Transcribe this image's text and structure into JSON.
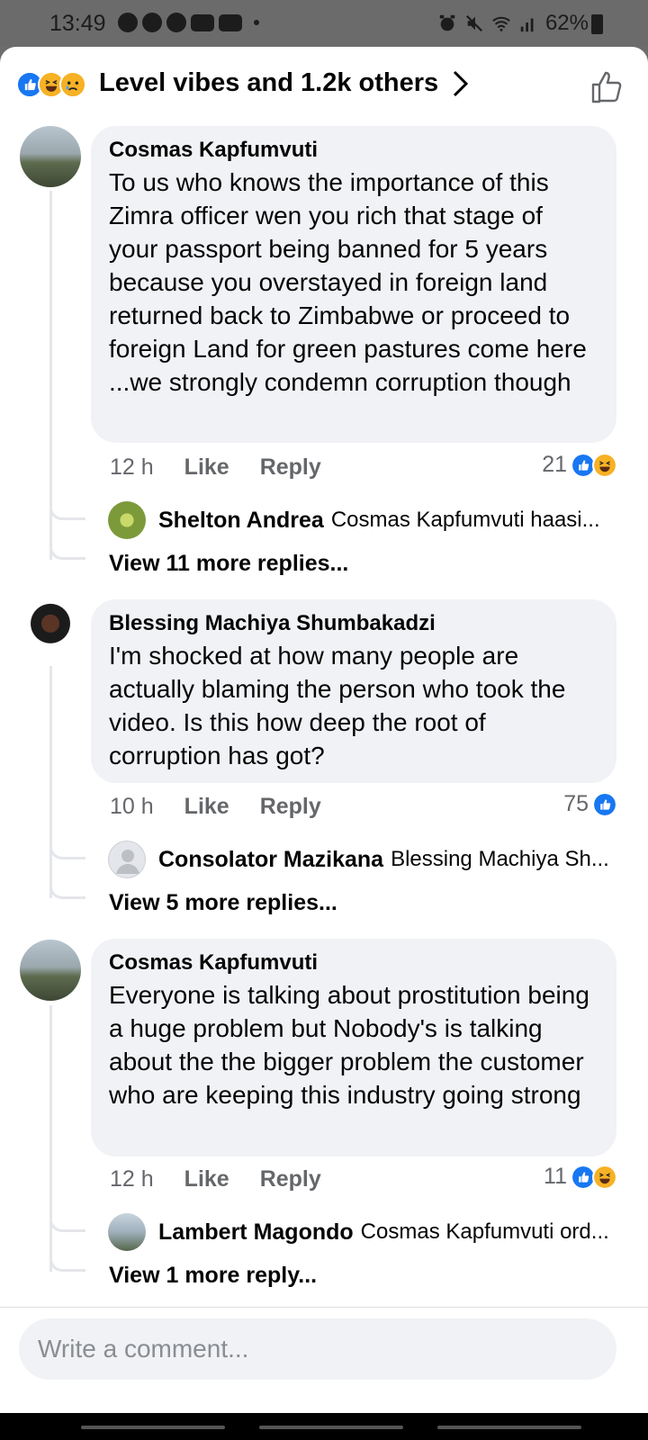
{
  "status_bar": {
    "time": "13:49",
    "battery": "62%",
    "icons": [
      "whatsapp-icon",
      "whatsapp-icon",
      "facebook-icon",
      "youtube-icon",
      "youtube-icon",
      "alarm-icon",
      "mute-icon",
      "wifi-icon",
      "signal-icon",
      "battery-icon"
    ]
  },
  "header": {
    "reaction_summary": "Level vibes and 1.2k others",
    "reaction_icons": [
      "like-icon",
      "haha-icon",
      "sad-icon"
    ]
  },
  "comments": [
    {
      "author": "Cosmas Kapfumvuti",
      "text": "To us who knows the importance of this Zimra officer wen you rich  that stage  of your passport being banned for 5 years because you overstayed in foreign land returned back to Zimbabwe or proceed to foreign Land for green pastures come here ...we strongly condemn corruption though",
      "time": "12 h",
      "like_label": "Like",
      "reply_label": "Reply",
      "reaction_count": "21",
      "reply_author": "Shelton Andrea",
      "reply_snippet": "Cosmas Kapfumvuti haasi...",
      "more_replies": "View 11 more replies..."
    },
    {
      "author": "Blessing Machiya Shumbakadzi",
      "text": "I'm shocked at how many people are actually blaming the person who took the video. Is this how deep the root of corruption has got?",
      "time": "10 h",
      "like_label": "Like",
      "reply_label": "Reply",
      "reaction_count": "75",
      "reply_author": "Consolator Mazikana",
      "reply_snippet": "Blessing Machiya Sh...",
      "more_replies": "View 5 more replies..."
    },
    {
      "author": "Cosmas Kapfumvuti",
      "text": "Everyone is talking about prostitution being a huge problem but Nobody's is talking about the the bigger problem the customer who are keeping this industry going strong",
      "time": "12 h",
      "like_label": "Like",
      "reply_label": "Reply",
      "reaction_count": "11",
      "reply_author": "Lambert Magondo",
      "reply_snippet": "Cosmas Kapfumvuti ord...",
      "more_replies": "View 1 more reply..."
    }
  ],
  "composer": {
    "placeholder": "Write a comment..."
  },
  "colors": {
    "like_blue": "#1877f2",
    "haha_yellow": "#f7b125",
    "bubble_bg": "#f0f2f5",
    "meta_grey": "#65676b"
  }
}
